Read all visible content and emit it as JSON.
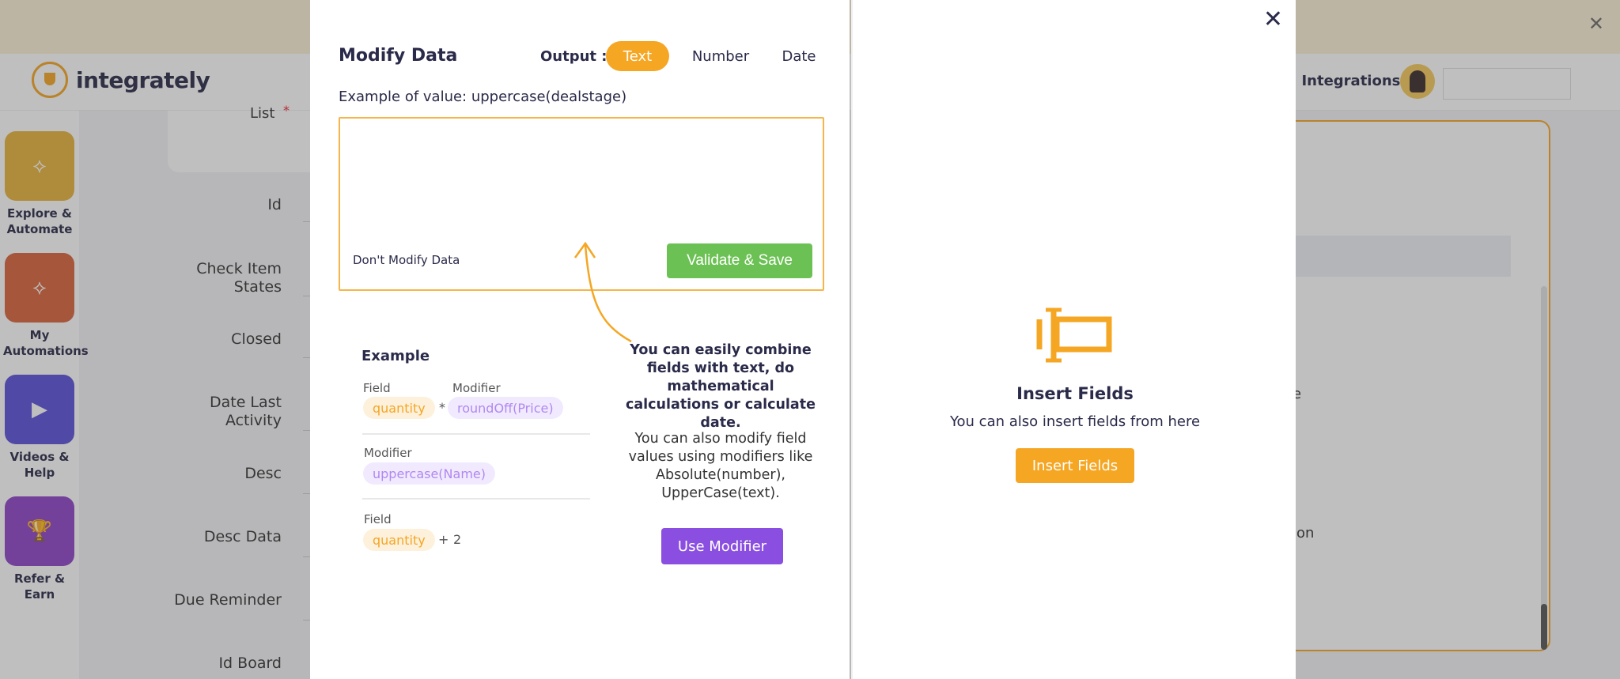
{
  "background": {
    "banner": {
      "close_icon": "close-icon"
    },
    "header": {
      "logo_text": "integrately",
      "right_text": ": Integrations"
    },
    "sidebar": {
      "items": [
        {
          "label": "Explore & Automate",
          "icon": "share-nodes-icon",
          "color": "#e8b23c"
        },
        {
          "label": "My Automations",
          "icon": "share-nodes-icon",
          "color": "#d9633b"
        },
        {
          "label": "Videos & Help",
          "icon": "play-icon",
          "color": "#5a4fd8"
        },
        {
          "label": "Refer & Earn",
          "icon": "trophy-icon",
          "color": "#8e44c8"
        }
      ]
    },
    "form": {
      "list_label": "List",
      "list_required": "*",
      "fields": [
        "Id",
        "Check Item States",
        "Closed",
        "Date Last Activity",
        "Desc",
        "Desc Data",
        "Due Reminder",
        "Id Board"
      ]
    },
    "right_fragments": [
      "e",
      "ion"
    ]
  },
  "modal": {
    "title": "Modify Data",
    "output_label": "Output :",
    "output_tabs": [
      {
        "label": "Text",
        "active": true
      },
      {
        "label": "Number",
        "active": false
      },
      {
        "label": "Date",
        "active": false
      }
    ],
    "example_hint": "Example of value: uppercase(dealstage)",
    "editor": {
      "dont_modify": "Don't Modify Data",
      "validate_button": "Validate & Save"
    },
    "example": {
      "title": "Example",
      "row1": {
        "field_label": "Field",
        "modifier_label": "Modifier",
        "field": "quantity",
        "op": "*",
        "modifier": "roundOff(Price)"
      },
      "row2": {
        "modifier_label": "Modifier",
        "modifier": "uppercase(Name)"
      },
      "row3": {
        "field_label": "Field",
        "field": "quantity",
        "op": "+",
        "value": "2"
      }
    },
    "tip_bold": "You can easily combine fields with text, do mathematical calculations or calculate date.",
    "tip_text": "You can also modify field values using modifiers like Absolute(number), UpperCase(text).",
    "use_modifier_button": "Use Modifier",
    "insert": {
      "title": "Insert Fields",
      "subtitle": "You can also insert fields from here",
      "button": "Insert Fields"
    },
    "colors": {
      "accent": "#f5a623",
      "validate": "#6cc154",
      "modifier": "#8a4fe0",
      "text_dark": "#2a2a4a"
    }
  }
}
